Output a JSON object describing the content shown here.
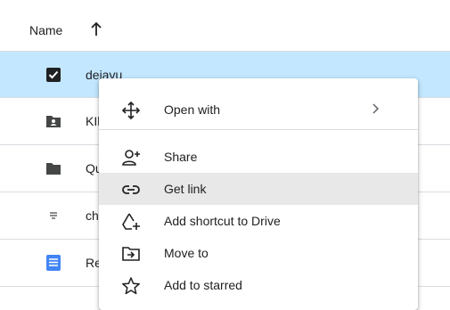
{
  "header": {
    "name_label": "Name",
    "sort_icon": "arrow-up-icon"
  },
  "rows": [
    {
      "label": "dejavu",
      "icon": "checkbox-checked-icon",
      "selected": true
    },
    {
      "label": "KIl",
      "icon": "shared-folder-icon"
    },
    {
      "label": "Qu",
      "icon": "folder-icon"
    },
    {
      "label": "ch",
      "icon": "text-file-icon"
    },
    {
      "label": "Re",
      "icon": "docs-icon"
    }
  ],
  "menu": {
    "items": [
      {
        "label": "Open with",
        "icon": "open-with-icon",
        "submenu": true
      },
      {
        "label": "Share",
        "icon": "share-icon"
      },
      {
        "label": "Get link",
        "icon": "link-icon",
        "hover": true
      },
      {
        "label": "Add shortcut to Drive",
        "icon": "add-shortcut-icon"
      },
      {
        "label": "Move to",
        "icon": "move-to-icon"
      },
      {
        "label": "Add to starred",
        "icon": "star-icon"
      }
    ]
  },
  "colors": {
    "selected_row": "#c2e7ff",
    "hover_item": "#e8e8e8",
    "docs_blue": "#4285f4"
  }
}
